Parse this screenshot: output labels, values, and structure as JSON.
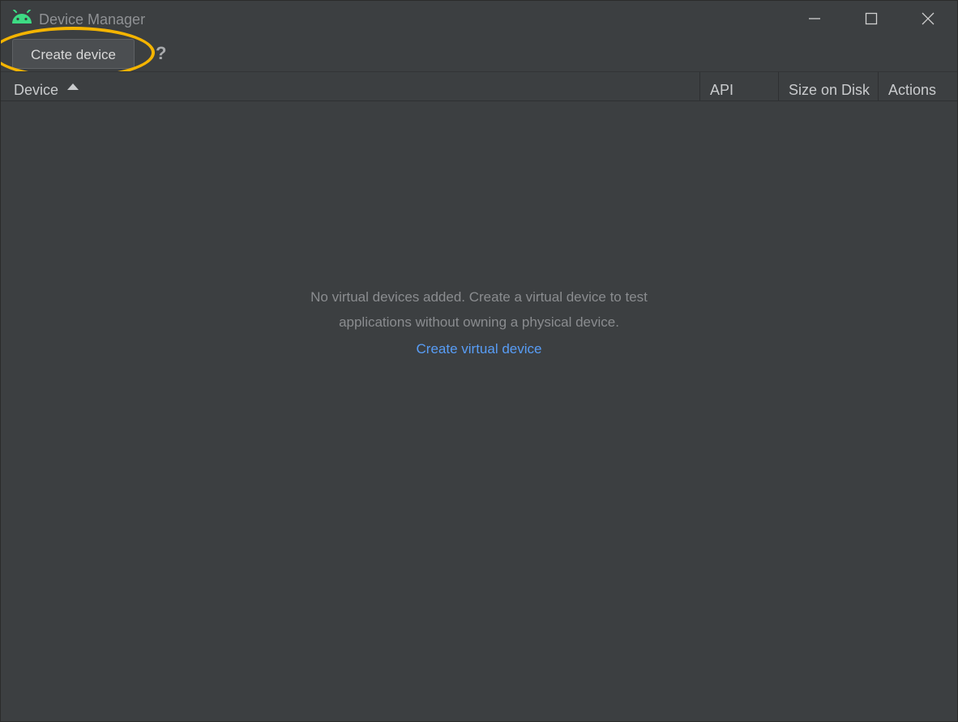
{
  "window": {
    "title": "Device Manager",
    "app_icon": "android-icon",
    "controls": {
      "minimize": "minimize-icon",
      "maximize": "maximize-icon",
      "close": "close-icon"
    }
  },
  "toolbar": {
    "create_device_label": "Create device",
    "help_label": "?"
  },
  "table": {
    "columns": [
      "Device",
      "API",
      "Size on Disk",
      "Actions"
    ],
    "sort_column": "Device",
    "sort_direction": "ascending",
    "rows": []
  },
  "empty_state": {
    "message_line1": "No virtual devices added. Create a virtual device to test",
    "message_line2": "applications without owning a physical device.",
    "link_label": "Create virtual device"
  },
  "colors": {
    "background": "#3c3f41",
    "link": "#589df6",
    "highlight_ring": "#f4b400",
    "android_green": "#3ddc84"
  }
}
